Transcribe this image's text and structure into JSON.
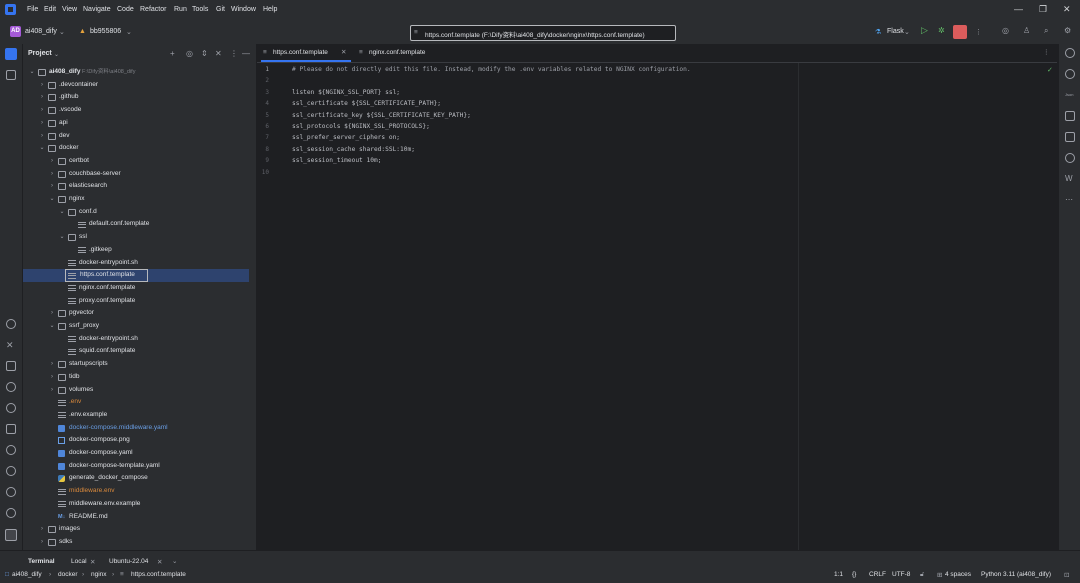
{
  "menu": [
    "File",
    "Edit",
    "View",
    "Navigate",
    "Code",
    "Refactor",
    "Run",
    "Tools",
    "Git",
    "Window",
    "Help"
  ],
  "toolbar": {
    "project_badge": "AD",
    "project_name": "ai408_dify",
    "branch": "bb955806",
    "path_title": "https.conf.template (F:\\Dify资料\\ai408_dify\\docker\\nginx\\https.conf.template)",
    "run_config": "Flask"
  },
  "project_panel": {
    "title": "Project",
    "root_name": "ai408_dify",
    "root_path": "F:\\Dify资料\\ai408_dify",
    "tree": [
      {
        "label": "ai408_dify",
        "depth": 0,
        "type": "folder",
        "open": true
      },
      {
        "label": ".devcontainer",
        "depth": 1,
        "type": "folder",
        "open": false
      },
      {
        "label": ".github",
        "depth": 1,
        "type": "folder",
        "open": false
      },
      {
        "label": ".vscode",
        "depth": 1,
        "type": "folder",
        "open": false
      },
      {
        "label": "api",
        "depth": 1,
        "type": "folder",
        "open": false
      },
      {
        "label": "dev",
        "depth": 1,
        "type": "folder",
        "open": false
      },
      {
        "label": "docker",
        "depth": 1,
        "type": "folder",
        "open": true
      },
      {
        "label": "certbot",
        "depth": 2,
        "type": "folder",
        "open": false
      },
      {
        "label": "couchbase-server",
        "depth": 2,
        "type": "folder",
        "open": false
      },
      {
        "label": "elasticsearch",
        "depth": 2,
        "type": "folder",
        "open": false
      },
      {
        "label": "nginx",
        "depth": 2,
        "type": "folder",
        "open": true
      },
      {
        "label": "conf.d",
        "depth": 3,
        "type": "folder",
        "open": true
      },
      {
        "label": "default.conf.template",
        "depth": 4,
        "type": "file"
      },
      {
        "label": "ssl",
        "depth": 3,
        "type": "folder",
        "open": true
      },
      {
        "label": ".gitkeep",
        "depth": 4,
        "type": "file"
      },
      {
        "label": "docker-entrypoint.sh",
        "depth": 3,
        "type": "file"
      },
      {
        "label": "https.conf.template",
        "depth": 3,
        "type": "file",
        "selected": true
      },
      {
        "label": "nginx.conf.template",
        "depth": 3,
        "type": "file"
      },
      {
        "label": "proxy.conf.template",
        "depth": 3,
        "type": "file"
      },
      {
        "label": "pgvector",
        "depth": 2,
        "type": "folder",
        "open": false
      },
      {
        "label": "ssrf_proxy",
        "depth": 2,
        "type": "folder",
        "open": true
      },
      {
        "label": "docker-entrypoint.sh",
        "depth": 3,
        "type": "file"
      },
      {
        "label": "squid.conf.template",
        "depth": 3,
        "type": "file"
      },
      {
        "label": "startupscripts",
        "depth": 2,
        "type": "folder",
        "open": false
      },
      {
        "label": "tidb",
        "depth": 2,
        "type": "folder",
        "open": false
      },
      {
        "label": "volumes",
        "depth": 2,
        "type": "folder",
        "open": false
      },
      {
        "label": ".env",
        "depth": 2,
        "type": "file",
        "color": "orange"
      },
      {
        "label": ".env.example",
        "depth": 2,
        "type": "file"
      },
      {
        "label": "docker-compose.middleware.yaml",
        "depth": 2,
        "type": "yaml",
        "color": "blue"
      },
      {
        "label": "docker-compose.png",
        "depth": 2,
        "type": "png"
      },
      {
        "label": "docker-compose.yaml",
        "depth": 2,
        "type": "yaml"
      },
      {
        "label": "docker-compose-template.yaml",
        "depth": 2,
        "type": "yaml"
      },
      {
        "label": "generate_docker_compose",
        "depth": 2,
        "type": "py"
      },
      {
        "label": "middleware.env",
        "depth": 2,
        "type": "file",
        "color": "orange"
      },
      {
        "label": "middleware.env.example",
        "depth": 2,
        "type": "file"
      },
      {
        "label": "README.md",
        "depth": 2,
        "type": "md"
      },
      {
        "label": "images",
        "depth": 1,
        "type": "folder",
        "open": false
      },
      {
        "label": "sdks",
        "depth": 1,
        "type": "folder",
        "open": false
      }
    ]
  },
  "tabs": [
    {
      "label": "https.conf.template",
      "active": true
    },
    {
      "label": "nginx.conf.template",
      "active": false
    }
  ],
  "editor": {
    "lines": [
      "# Please do not directly edit this file. Instead, modify the .env variables related to NGINX configuration.",
      "",
      "listen ${NGINX_SSL_PORT} ssl;",
      "ssl_certificate ${SSL_CERTIFICATE_PATH};",
      "ssl_certificate_key ${SSL_CERTIFICATE_KEY_PATH};",
      "ssl_protocols ${NGINX_SSL_PROTOCOLS};",
      "ssl_prefer_server_ciphers on;",
      "ssl_session_cache shared:SSL:10m;",
      "ssl_session_timeout 10m;",
      ""
    ],
    "line_numbers": [
      "1",
      "2",
      "3",
      "4",
      "5",
      "6",
      "7",
      "8",
      "9",
      "10"
    ]
  },
  "bottom": {
    "tabs": [
      "Terminal",
      "Local",
      "Ubuntu-22.04"
    ],
    "breadcrumb": [
      "ai408_dify",
      "docker",
      "nginx",
      "https.conf.template"
    ],
    "status": {
      "position": "1:1",
      "braces": "{}",
      "line_sep": "CRLF",
      "encoding": "UTF-8",
      "indent": "4 spaces",
      "interpreter": "Python 3.11 (ai408_dify)"
    }
  }
}
